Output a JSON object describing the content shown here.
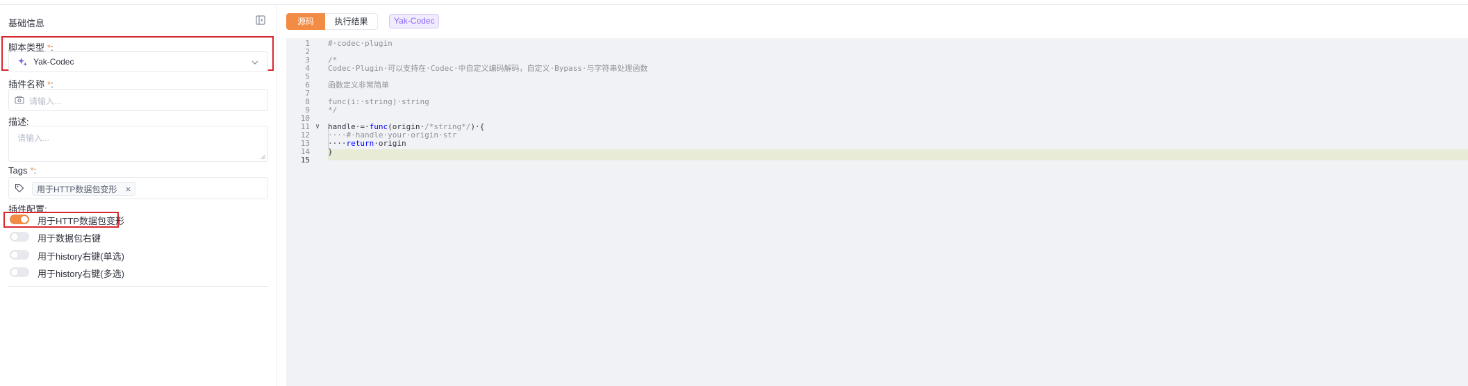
{
  "left": {
    "title": "基础信息",
    "fields": {
      "script_type": {
        "label": "脚本类型",
        "required_mark": "*",
        "colon": ":",
        "value": "Yak-Codec"
      },
      "plugin_name": {
        "label": "插件名称",
        "required_mark": "*",
        "colon": ":",
        "placeholder": "请输入..."
      },
      "description": {
        "label": "描述",
        "colon": ":",
        "placeholder": "请输入..."
      },
      "tags": {
        "label": "Tags",
        "required_mark": "*",
        "colon": ":",
        "chips": [
          "用于HTTP数据包变形"
        ],
        "chip_close": "×"
      },
      "plugin_config": {
        "label": "插件配置",
        "colon": ":",
        "switches": [
          {
            "label": "用于HTTP数据包变形",
            "on": true
          },
          {
            "label": "用于数据包右键",
            "on": false
          },
          {
            "label": "用于history右键(单选)",
            "on": false
          },
          {
            "label": "用于history右键(多选)",
            "on": false
          }
        ]
      }
    }
  },
  "right": {
    "tabs": [
      {
        "label": "源码",
        "active": true
      },
      {
        "label": "执行结果",
        "active": false
      }
    ],
    "badge": "Yak-Codec",
    "editor": {
      "line_numbers": [
        "1",
        "2",
        "3",
        "4",
        "5",
        "6",
        "7",
        "8",
        "9",
        "10",
        "11",
        "12",
        "13",
        "14",
        "15"
      ],
      "lines": [
        "#·codec·plugin",
        "",
        "/*",
        "Codec·Plugin·可以支持在·Codec·中自定义编码解码，自定义·Bypass·与字符串处理函数",
        "",
        "函数定义非常简单",
        "",
        "func(i:·string)·string",
        "*/",
        "",
        "handle·=·func(origin·/*string*/)·{",
        "····#·handle·your·origin·str",
        "····return·origin",
        "}",
        ""
      ],
      "tokens": {
        "l11_a": "handle·=·",
        "l11_kw": "func",
        "l11_b": "(origin·",
        "l11_c": "/*string*/",
        "l11_d": ")·{",
        "l13_a": "····",
        "l13_kw": "return",
        "l13_b": "·origin"
      },
      "fold_marker": "∨"
    }
  },
  "colors": {
    "accent": "#f28b44",
    "highlight_border": "#d8262c",
    "badge_text": "#8863f7",
    "editor_bg": "#f0f2f5",
    "current_line": "#e8ecd7"
  }
}
